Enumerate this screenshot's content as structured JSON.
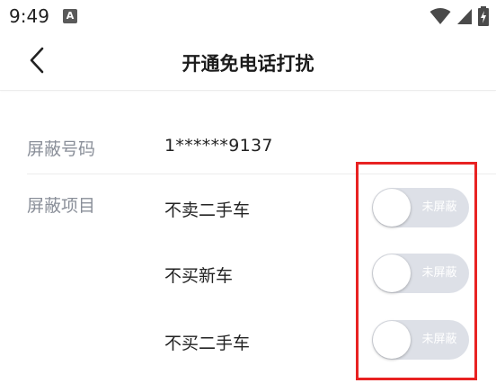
{
  "status_bar": {
    "time": "9:49",
    "notification_icon": "a-notification-icon",
    "icons": [
      "wifi-icon",
      "signal-icon",
      "battery-charging-icon"
    ]
  },
  "nav": {
    "title": "开通免电话打扰",
    "back_icon": "chevron-left-icon"
  },
  "number_row": {
    "label": "屏蔽号码",
    "value": "1******9137"
  },
  "items_row": {
    "label": "屏蔽项目",
    "items": [
      {
        "label": "不卖二手车",
        "toggle_text": "未屏蔽",
        "toggle_on": false
      },
      {
        "label": "不买新车",
        "toggle_text": "未屏蔽",
        "toggle_on": false
      },
      {
        "label": "不买二手车",
        "toggle_text": "未屏蔽",
        "toggle_on": false
      }
    ]
  },
  "colors": {
    "toggle_off_bg": "#dde0e7",
    "annotation_red": "#e82222",
    "label_gray": "#8a8f99"
  }
}
